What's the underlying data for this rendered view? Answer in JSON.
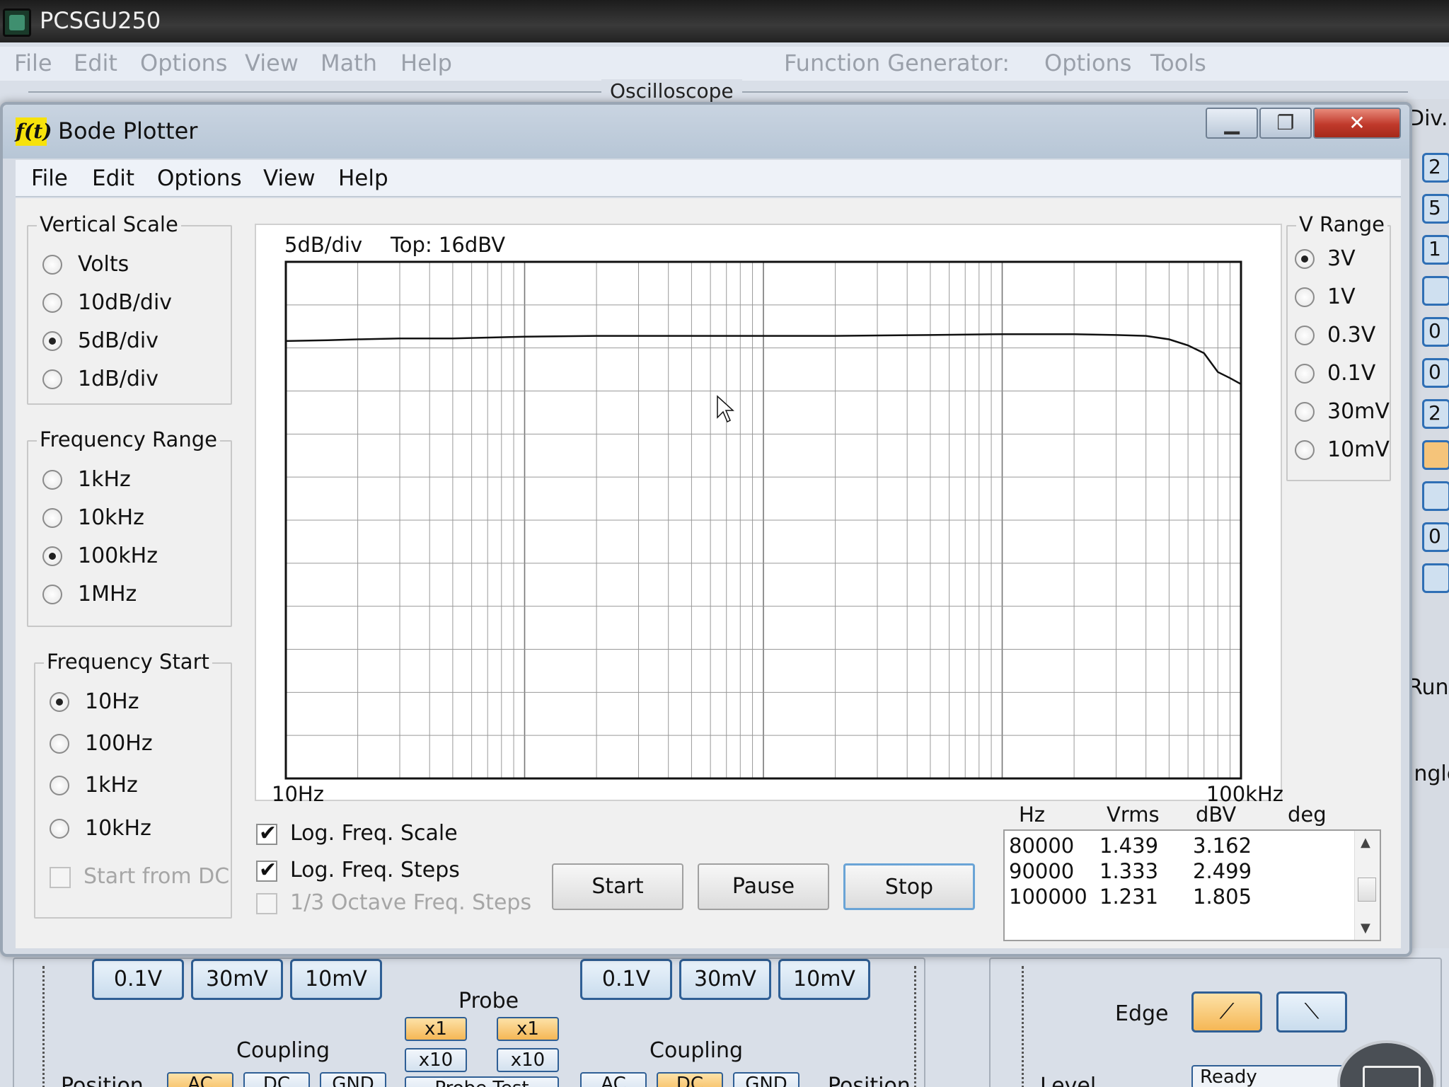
{
  "app": {
    "title": "PCSGU250",
    "menu": [
      "File",
      "Edit",
      "Options",
      "View",
      "Math",
      "Help",
      "Function Generator:",
      "Options",
      "Tools"
    ],
    "section_label": "Oscilloscope"
  },
  "right_strip": {
    "top_label": "Div.",
    "buttons": [
      "2",
      "5",
      "1",
      "",
      "0",
      "0",
      "2",
      "",
      "",
      "0",
      ""
    ],
    "run_label": "Run",
    "single_label": "ingle"
  },
  "bottom": {
    "ch1_buttons": [
      "0.1V",
      "30mV",
      "10mV"
    ],
    "ch2_buttons": [
      "0.1V",
      "30mV",
      "10mV"
    ],
    "probe_label": "Probe",
    "probe_ch1": [
      "x1",
      "x10"
    ],
    "probe_ch2": [
      "x1",
      "x10"
    ],
    "coupling_label": "Coupling",
    "coupling_ch1": [
      "AC",
      "DC",
      "GND"
    ],
    "coupling_ch2": [
      "AC",
      "DC",
      "GND"
    ],
    "probe_test": "Probe Test",
    "position_label": "Position",
    "edge_label": "Edge",
    "level_label": "Level",
    "status": "Ready"
  },
  "bode": {
    "icon_text": "f(t)",
    "title": "Bode Plotter",
    "menu": [
      "File",
      "Edit",
      "Options",
      "View",
      "Help"
    ],
    "vertical_scale": {
      "legend": "Vertical Scale",
      "options": [
        "Volts",
        "10dB/div",
        "5dB/div",
        "1dB/div"
      ],
      "selected": 2
    },
    "frequency_range": {
      "legend": "Frequency Range",
      "options": [
        "1kHz",
        "10kHz",
        "100kHz",
        "1MHz"
      ],
      "selected": 2
    },
    "frequency_start": {
      "legend": "Frequency Start",
      "options": [
        "10Hz",
        "100Hz",
        "1kHz",
        "10kHz"
      ],
      "selected": 0,
      "start_from_dc": "Start from DC"
    },
    "v_range": {
      "legend": "V Range",
      "options": [
        "3V",
        "1V",
        "0.3V",
        "0.1V",
        "30mV",
        "10mV"
      ],
      "selected": 0
    },
    "plot": {
      "scale_label": "5dB/div",
      "top_label": "Top:  16dBV",
      "x_start_label": "10Hz",
      "x_end_label": "100kHz"
    },
    "checkboxes": [
      {
        "label": "Log. Freq. Scale",
        "checked": true,
        "enabled": true
      },
      {
        "label": "Log. Freq. Steps",
        "checked": true,
        "enabled": true
      },
      {
        "label": "1/3 Octave Freq. Steps",
        "checked": false,
        "enabled": false
      }
    ],
    "buttons": {
      "start": "Start",
      "pause": "Pause",
      "stop": "Stop"
    },
    "readout": {
      "headers": [
        "Hz",
        "Vrms",
        "dBV",
        "deg"
      ],
      "rows": [
        [
          "80000",
          "1.439",
          "3.162",
          ""
        ],
        [
          "90000",
          "1.333",
          "2.499",
          ""
        ],
        [
          "100000",
          "1.231",
          "1.805",
          ""
        ]
      ]
    }
  },
  "chart_data": {
    "type": "line",
    "xscale": "log",
    "xlim": [
      10,
      100000
    ],
    "ylim": [
      -44,
      16
    ],
    "y_units": "dBV",
    "x_units": "Hz",
    "grid": true,
    "x": [
      10,
      15,
      20,
      30,
      50,
      100,
      200,
      500,
      1000,
      2000,
      5000,
      10000,
      20000,
      30000,
      40000,
      50000,
      60000,
      70000,
      80000,
      90000,
      100000
    ],
    "series": [
      {
        "values": [
          6.8,
          6.9,
          7.0,
          7.1,
          7.1,
          7.3,
          7.4,
          7.4,
          7.4,
          7.4,
          7.5,
          7.6,
          7.6,
          7.5,
          7.4,
          7.0,
          6.3,
          5.4,
          3.2,
          2.5,
          1.8
        ]
      }
    ]
  }
}
